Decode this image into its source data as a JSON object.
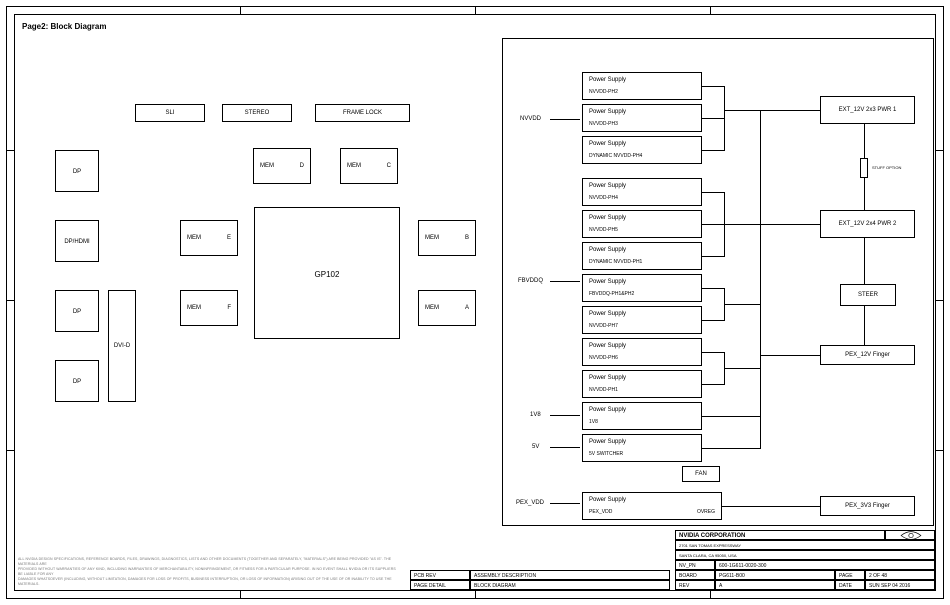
{
  "page_title": "Page2: Block Diagram",
  "left": {
    "ports": [
      "DP",
      "DP/HDMI",
      "DP",
      "DP"
    ],
    "dvi": "DVI-D",
    "top_row": [
      "SLI",
      "STEREO",
      "FRAME LOCK"
    ],
    "mem_d": {
      "l": "MEM",
      "r": "D"
    },
    "mem_c": {
      "l": "MEM",
      "r": "C"
    },
    "mem_e": {
      "l": "MEM",
      "r": "E"
    },
    "mem_b": {
      "l": "MEM",
      "r": "B"
    },
    "mem_f": {
      "l": "MEM",
      "r": "F"
    },
    "mem_a": {
      "l": "MEM",
      "r": "A"
    },
    "gpu": "GP102"
  },
  "rails": {
    "nvvdd": "NVVDD",
    "fbvddq": "FBVDDQ",
    "v1v8": "1V8",
    "v5": "5V",
    "pex_vdd": "PEX_VDD"
  },
  "ps": [
    {
      "t": "Power Supply",
      "s": "NVVDD-PH2"
    },
    {
      "t": "Power Supply",
      "s": "NVVDD-PH3"
    },
    {
      "t": "Power Supply",
      "s": "DYNAMIC NVVDD-PH4"
    },
    {
      "t": "Power Supply",
      "s": "NVVDD-PH4"
    },
    {
      "t": "Power Supply",
      "s": "NVVDD-PH5"
    },
    {
      "t": "Power Supply",
      "s": "DYNAMIC NVVDD-PH1"
    },
    {
      "t": "Power Supply",
      "s": "FBVDDQ-PH1&PH2"
    },
    {
      "t": "Power Supply",
      "s": "NVVDD-PH7"
    },
    {
      "t": "Power Supply",
      "s": "NVVDD-PH6"
    },
    {
      "t": "Power Supply",
      "s": "NVVDD-PH1"
    },
    {
      "t": "Power Supply",
      "s": "1V8"
    },
    {
      "t": "Power Supply",
      "s": "5V SWITCHER"
    },
    {
      "t": "Power Supply",
      "s": "PEX_VDD",
      "extra": "OVREG"
    }
  ],
  "right": {
    "ext1": "EXT_12V 2x3 PWR 1",
    "ext2": "EXT_12V 2x4 PWR 2",
    "stuff_option": "STUFF OPTION",
    "steer": "STEER",
    "pex12v": "PEX_12V Finger",
    "pex3v3": "PEX_3V3 Finger",
    "fan": "FAN"
  },
  "titleblock": {
    "company": "NVIDIA CORPORATION",
    "addr": "2701 SAN TOMAS EXPRESSWAY",
    "city": "SANTA CLARA, CA 95050, USA",
    "nvpn_l": "NV_PN",
    "nvpn_v": "600-1G611-0020-300",
    "board_l": "BOARD",
    "board_v": "PG611-B00",
    "rev_l": "REV",
    "rev_v": "A",
    "pg_l": "PAGE",
    "pg_v": "2 OF 48",
    "date_l": "DATE",
    "date_v": "SUN SEP 04 2016",
    "det_l": "PAGE DETAIL",
    "det_v": "BLOCK DIAGRAM",
    "asm_l": "PCB REV",
    "asm_v": "ASSEMBLY DESCRIPTION"
  },
  "disclaimer": {
    "l1": "ALL NVIDIA DESIGN SPECIFICATIONS, REFERENCE BOARDS, FILES, DRAWINGS, DIAGNOSTICS, LISTS AND OTHER DOCUMENTS (TOGETHER AND SEPARATELY, \"MATERIALS\") ARE BEING PROVIDED \"AS IS\". THE MATERIALS ARE",
    "l2": "PROVIDED WITHOUT WARRANTIES OF ANY KIND, INCLUDING WARRANTIES OF MERCHANTABILITY, NONINFRINGEMENT, OR FITNESS FOR A PARTICULAR PURPOSE. IN NO EVENT SHALL NVIDIA OR ITS SUPPLIERS BE LIABLE FOR ANY",
    "l3": "DAMAGES WHATSOEVER (INCLUDING, WITHOUT LIMITATION, DAMAGES FOR LOSS OF PROFITS, BUSINESS INTERRUPTION, OR LOSS OF INFORMATION) ARISING OUT OF THE USE OF OR INABILITY TO USE THE MATERIALS."
  }
}
